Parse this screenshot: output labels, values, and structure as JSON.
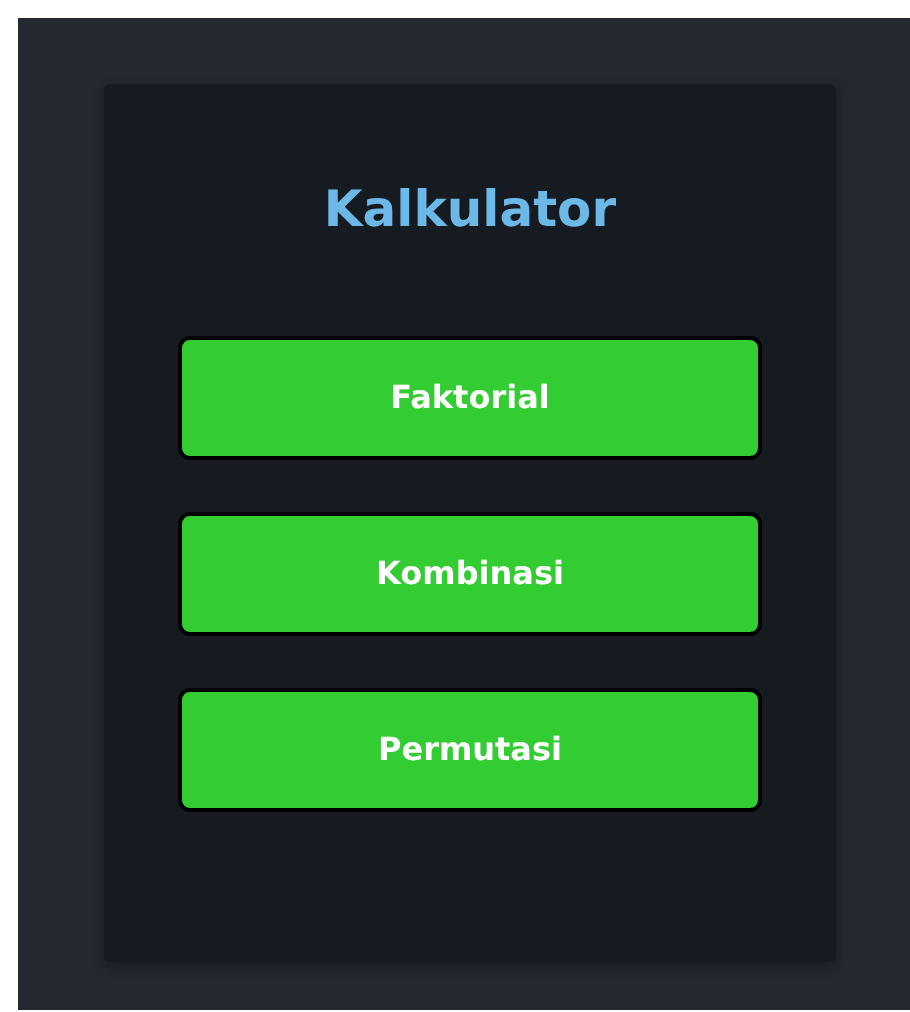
{
  "title": "Kalkulator",
  "buttons": [
    "Faktorial",
    "Kombinasi",
    "Permutasi"
  ]
}
